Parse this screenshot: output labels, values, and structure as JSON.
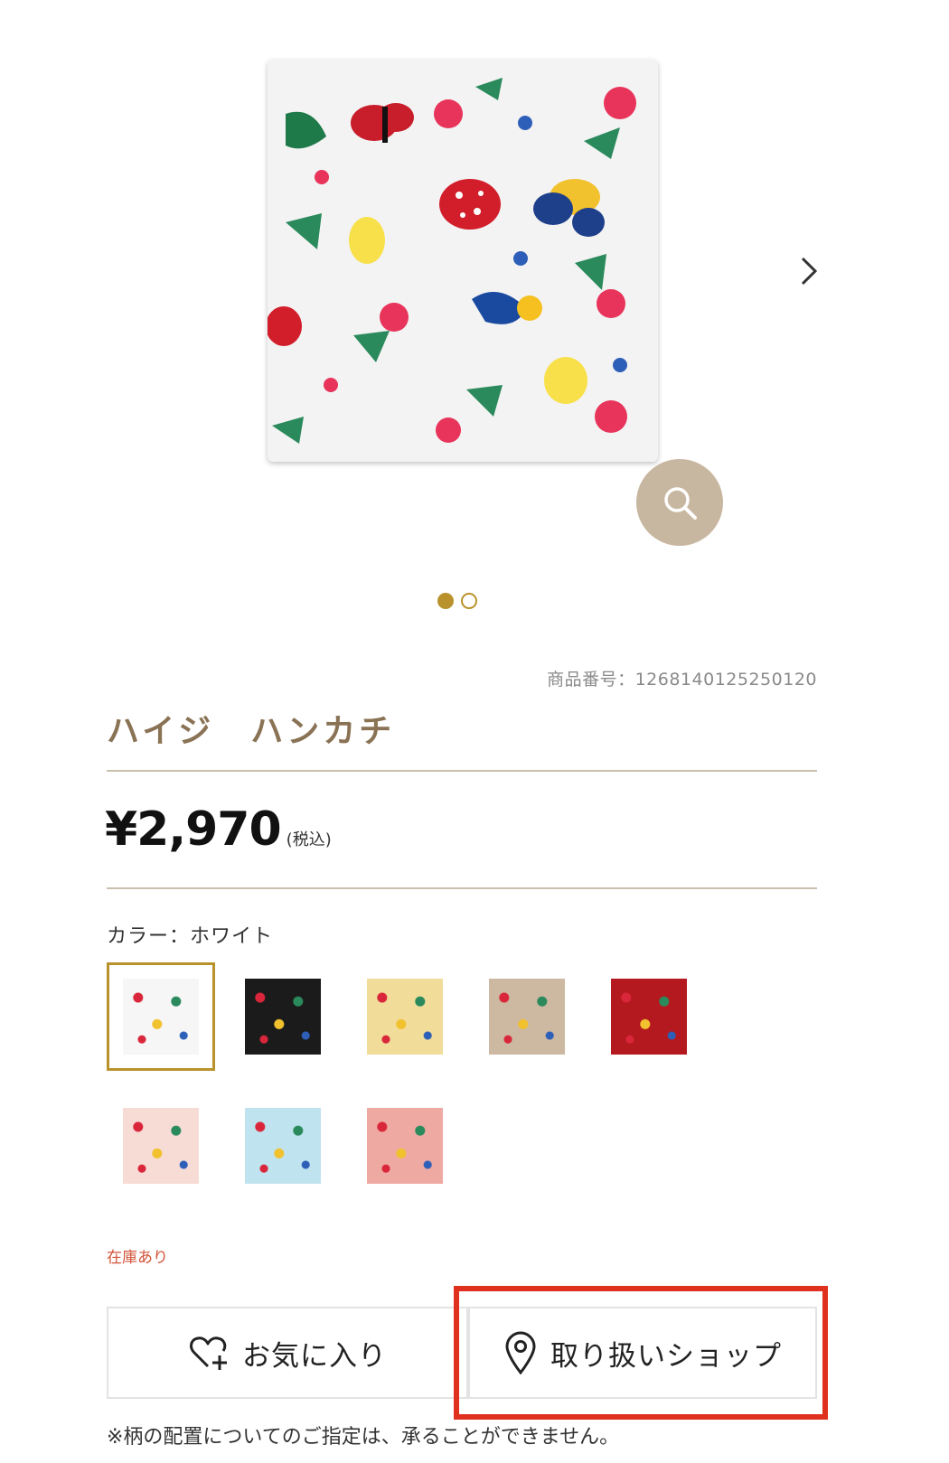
{
  "product": {
    "sku_label": "商品番号：1268140125250120",
    "title": "ハイジ　ハンカチ",
    "price": "¥2,970",
    "tax_note": "(税込)",
    "color_label": "カラー：ホワイト",
    "stock_status": "在庫あり"
  },
  "carousel": {
    "total_slides": 2,
    "active_slide": 1
  },
  "swatches": [
    {
      "name": "white",
      "bg": "#f6f6f6",
      "selected": true
    },
    {
      "name": "black",
      "bg": "#1b1b1b",
      "selected": false
    },
    {
      "name": "yellow",
      "bg": "#f1dc9a",
      "selected": false
    },
    {
      "name": "beige",
      "bg": "#cdb8a2",
      "selected": false
    },
    {
      "name": "red",
      "bg": "#b3191e",
      "selected": false
    },
    {
      "name": "light-pink",
      "bg": "#f7dcd6",
      "selected": false
    },
    {
      "name": "light-blue",
      "bg": "#bfe4ef",
      "selected": false
    },
    {
      "name": "pink",
      "bg": "#eea9a2",
      "selected": false
    }
  ],
  "actions": {
    "favorite_label": "お気に入り",
    "shop_label": "取り扱いショップ"
  },
  "footnote": "※柄の配置についてのご指定は、承ることができません。",
  "colors": {
    "accent": "#b9922c",
    "title": "#8a7355",
    "stock": "#d3543a",
    "highlight": "#e0301e",
    "zoom_bg": "#c8b7a0"
  }
}
